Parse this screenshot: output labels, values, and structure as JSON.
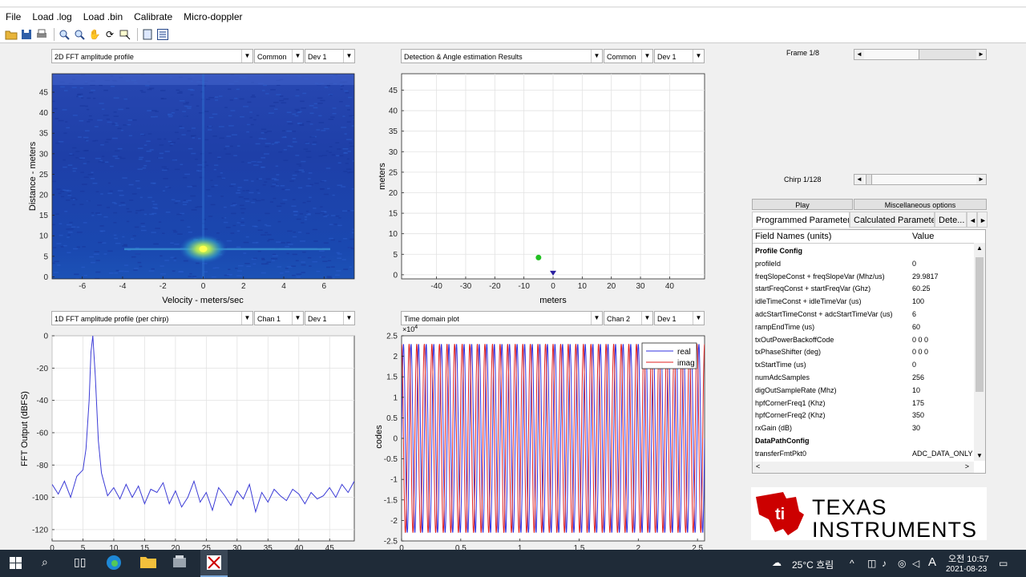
{
  "menu": {
    "items": [
      "File",
      "Load .log",
      "Load .bin",
      "Calibrate",
      "Micro-doppler"
    ]
  },
  "toolbar": {
    "icons": [
      "open-folder-icon",
      "save-icon",
      "print-icon",
      "zoom-in-icon",
      "zoom-out-icon",
      "pan-hand-icon",
      "rotate-icon",
      "data-cursor-icon",
      "legend-icon",
      "plot-browser-icon"
    ]
  },
  "plot_tl": {
    "select_main": "2D FFT amplitude profile",
    "select_a": "Common",
    "select_b": "Dev 1",
    "xlabel": "Velocity - meters/sec",
    "ylabel": "Distance - meters"
  },
  "plot_tr": {
    "select_main": "Detection & Angle estimation Results",
    "select_a": "Common",
    "select_b": "Dev 1",
    "xlabel": "meters",
    "ylabel": "meters"
  },
  "plot_bl": {
    "select_main": "1D FFT amplitude profile (per chirp)",
    "select_a": "Chan 1",
    "select_b": "Dev 1",
    "ylabel": "FFT Output (dBFS)"
  },
  "plot_br": {
    "select_main": "Time domain plot",
    "select_a": "Chan 2",
    "select_b": "Dev 1",
    "ylabel": "codes",
    "exponent": "×10",
    "exponent_power": "4",
    "legend_real": "real",
    "legend_imag": "imag"
  },
  "chart_data": [
    {
      "type": "heatmap",
      "title": "",
      "xlabel": "Velocity - meters/sec",
      "ylabel": "Distance - meters",
      "xlim": [
        -7.5,
        7.5
      ],
      "ylim": [
        -0.5,
        49.5
      ],
      "xticks": [
        -6,
        -4,
        -2,
        0,
        2,
        4,
        6
      ],
      "yticks": [
        0,
        5,
        10,
        15,
        20,
        25,
        30,
        35,
        40,
        45
      ],
      "peak": {
        "x": 0,
        "y": 6.8
      }
    },
    {
      "type": "scatter",
      "title": "",
      "xlabel": "meters",
      "ylabel": "meters",
      "xlim": [
        -52,
        52
      ],
      "ylim": [
        -1,
        49
      ],
      "grid": true,
      "xticks": [
        -40,
        -30,
        -20,
        -10,
        0,
        10,
        20,
        30,
        40
      ],
      "yticks": [
        0,
        5,
        10,
        15,
        20,
        25,
        30,
        35,
        40,
        45
      ],
      "points": [
        {
          "x": -5,
          "y": 4.2,
          "color": "#22c022",
          "marker": "circle"
        },
        {
          "x": 0,
          "y": 0,
          "color": "#2a1fa0",
          "marker": "triangle-down"
        }
      ]
    },
    {
      "type": "line",
      "title": "",
      "xlabel": "",
      "ylabel": "FFT Output (dBFS)",
      "xlim": [
        0,
        49
      ],
      "ylim": [
        -127,
        0
      ],
      "grid": true,
      "xticks": [
        0,
        5,
        10,
        15,
        20,
        25,
        30,
        35,
        40,
        45
      ],
      "yticks": [
        0,
        -20,
        -40,
        -60,
        -80,
        -100,
        -120
      ],
      "x": [
        0,
        1,
        2,
        3,
        4,
        5,
        5.5,
        6,
        6.3,
        6.6,
        7,
        7.5,
        8,
        9,
        10,
        11,
        12,
        13,
        14,
        15,
        16,
        17,
        18,
        19,
        20,
        21,
        22,
        23,
        24,
        25,
        26,
        27,
        28,
        29,
        30,
        31,
        32,
        33,
        34,
        35,
        36,
        37,
        38,
        39,
        40,
        41,
        42,
        43,
        44,
        45,
        46,
        47,
        48,
        49
      ],
      "values": [
        -92,
        -98,
        -90,
        -100,
        -87,
        -83,
        -70,
        -40,
        -10,
        0,
        -25,
        -65,
        -85,
        -99,
        -94,
        -101,
        -92,
        -100,
        -93,
        -104,
        -95,
        -97,
        -91,
        -104,
        -96,
        -106,
        -100,
        -90,
        -103,
        -97,
        -108,
        -94,
        -99,
        -105,
        -96,
        -101,
        -92,
        -109,
        -97,
        -103,
        -95,
        -99,
        -102,
        -95,
        -98,
        -104,
        -97,
        -101,
        -99,
        -94,
        -100,
        -92,
        -97,
        -90
      ],
      "color": "#3b3bd6"
    },
    {
      "type": "line",
      "title": "",
      "xlabel": "",
      "ylabel": "codes",
      "xlim": [
        0,
        2.56
      ],
      "ylim": [
        -25000,
        25000
      ],
      "grid": false,
      "xticks": [
        0,
        0.5,
        1,
        1.5,
        2,
        2.5
      ],
      "xtick_labels": [
        "0",
        "0.5",
        "1",
        "1.5",
        "2",
        "2.5"
      ],
      "yticks": [
        -25000,
        -20000,
        -15000,
        -10000,
        -5000,
        0,
        5000,
        10000,
        15000,
        20000,
        25000
      ],
      "ytick_labels": [
        "-2.5",
        "-2",
        "-1.5",
        "-1",
        "-0.5",
        "0",
        "0.5",
        "1",
        "1.5",
        "2",
        "2.5"
      ],
      "series": [
        {
          "name": "real",
          "color": "#3030e0",
          "amplitude": 23000,
          "cycles": 40,
          "phase": 0
        },
        {
          "name": "imag",
          "color": "#e02020",
          "amplitude": 23000,
          "cycles": 40,
          "phase": 1.5708
        }
      ],
      "legend": "top-right"
    }
  ],
  "side": {
    "frame_label": "Frame 1/8",
    "chirp_label": "Chirp 1/128",
    "play_label": "Play",
    "misc_label": "Miscellaneous options",
    "tabs": [
      "Programmed Parameters",
      "Calculated Parameters",
      "Dete..."
    ],
    "table_head": {
      "field": "Field Names      (units)",
      "value": "Value"
    },
    "rows": [
      {
        "field": "Profile Config",
        "value": "",
        "section": true
      },
      {
        "field": "profileId",
        "value": "0"
      },
      {
        "field": "freqSlopeConst + freqSlopeVar (Mhz/us)",
        "value": "29.9817"
      },
      {
        "field": "startFreqConst + startFreqVar (Ghz)",
        "value": "60.25"
      },
      {
        "field": "idleTimeConst + idleTimeVar (us)",
        "value": "100"
      },
      {
        "field": "adcStartTimeConst + adcStartTimeVar (us)",
        "value": "6"
      },
      {
        "field": "rampEndTime (us)",
        "value": "60"
      },
      {
        "field": "txOutPowerBackoffCode",
        "value": "0 0 0"
      },
      {
        "field": "txPhaseShifter (deg)",
        "value": "0 0 0"
      },
      {
        "field": "txStartTime (us)",
        "value": "0"
      },
      {
        "field": "numAdcSamples",
        "value": "256"
      },
      {
        "field": "digOutSampleRate (Mhz)",
        "value": "10"
      },
      {
        "field": "hpfCornerFreq1 (Khz)",
        "value": "175"
      },
      {
        "field": "hpfCornerFreq2 (Khz)",
        "value": "350"
      },
      {
        "field": "rxGain (dB)",
        "value": "30"
      },
      {
        "field": "DataPathConfig",
        "value": "",
        "section": true
      },
      {
        "field": "transferFmtPkt0",
        "value": "ADC_DATA_ONLY"
      }
    ]
  },
  "logo": {
    "line1": "TEXAS",
    "line2": "INSTRUMENTS"
  },
  "taskbar": {
    "weather": "25°C 흐림",
    "ime": "A",
    "time": "오전 10:57",
    "date": "2021-08-23"
  }
}
